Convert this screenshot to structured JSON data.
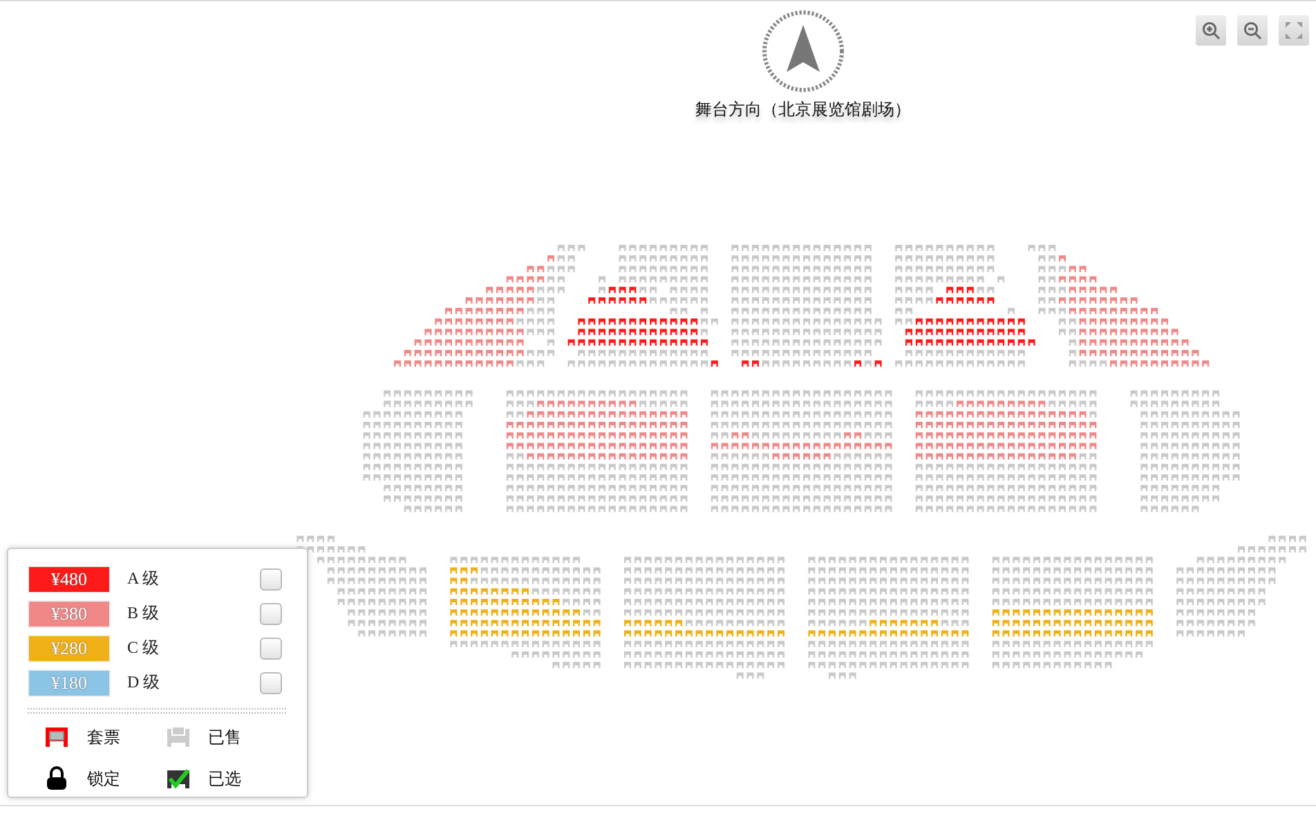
{
  "stage": {
    "label": "舞台方向（北京展览馆剧场）"
  },
  "zoom_controls": [
    {
      "kind": "zoom_in"
    },
    {
      "kind": "zoom_out"
    },
    {
      "kind": "fullscreen"
    }
  ],
  "legend": {
    "prices": [
      {
        "price": "¥480",
        "grade": "A 级",
        "color": "#ff1a1a",
        "checked": false
      },
      {
        "price": "¥380",
        "grade": "B 级",
        "color": "#f08888",
        "checked": false
      },
      {
        "price": "¥280",
        "grade": "C 级",
        "color": "#f0b018",
        "checked": false
      },
      {
        "price": "¥180",
        "grade": "D 级",
        "color": "#8cc4e6",
        "checked": false
      }
    ],
    "statuses": [
      {
        "kind": "package",
        "label": "套票"
      },
      {
        "kind": "sold",
        "label": "已售"
      },
      {
        "kind": "locked",
        "label": "锁定"
      },
      {
        "kind": "selected",
        "label": "已选"
      }
    ]
  }
}
